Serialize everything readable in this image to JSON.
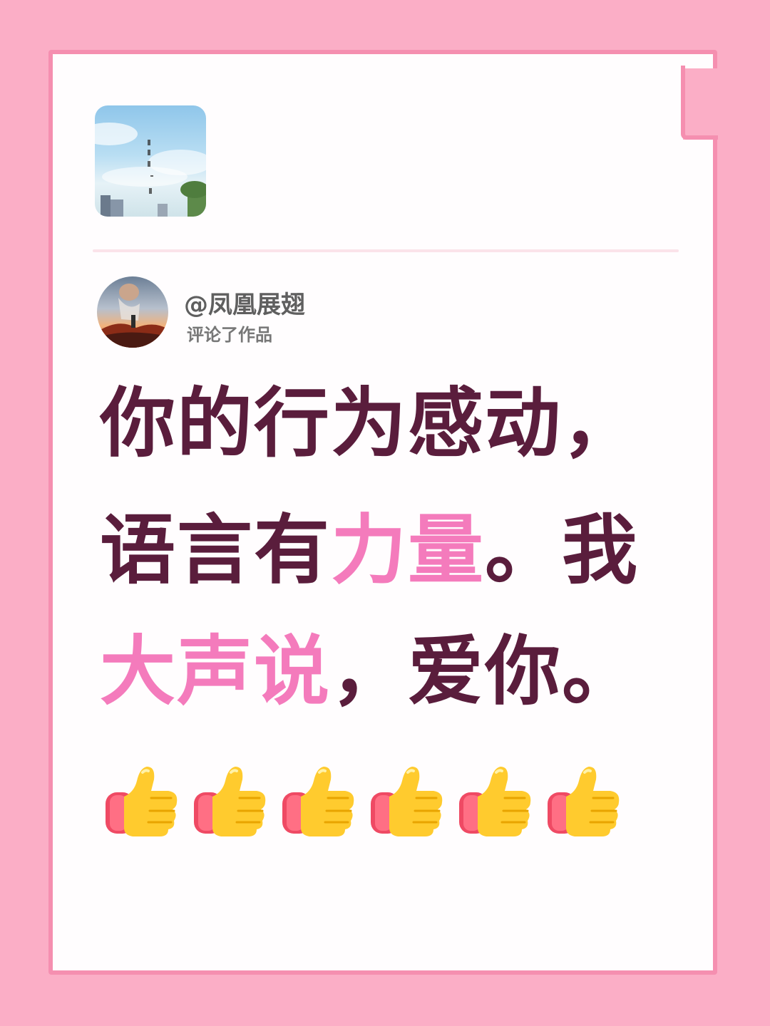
{
  "post": {
    "username": "@凤凰展翅",
    "action": "评论了作品"
  },
  "quote": {
    "line1": [
      {
        "text": "你的行为感动，",
        "accent": false
      }
    ],
    "line2": [
      {
        "text": "语言有",
        "accent": false
      },
      {
        "text": "力量",
        "accent": true
      },
      {
        "text": "。我",
        "accent": false
      }
    ],
    "line3": [
      {
        "text": "大声说",
        "accent": true
      },
      {
        "text": "，爱你。",
        "accent": false
      }
    ]
  },
  "reactions": {
    "icon": "thumbs-up-icon",
    "count": 6
  },
  "colors": {
    "background": "#fbaec6",
    "paper": "#fffdfe",
    "border": "#f58fb0",
    "text_dark": "#5a1d3c",
    "text_accent": "#f47bbc"
  }
}
